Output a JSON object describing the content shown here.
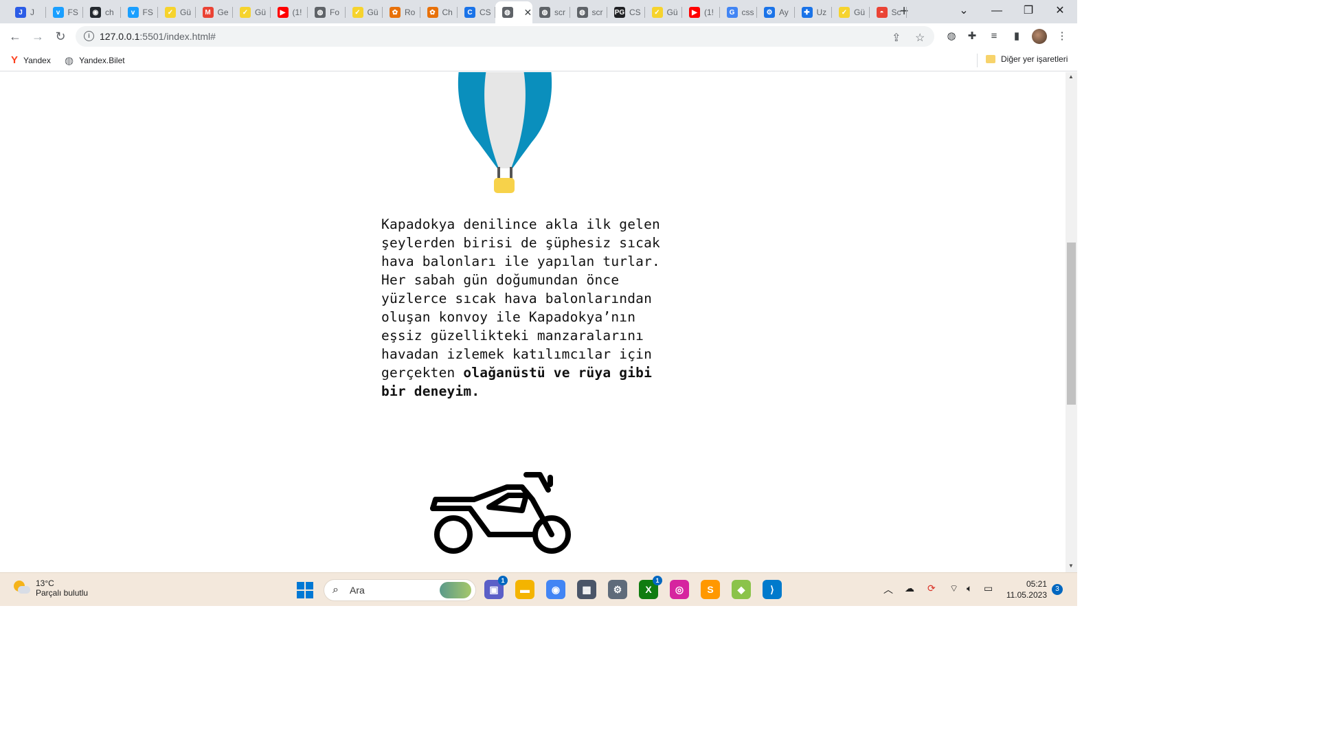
{
  "browser": {
    "tabs": [
      {
        "title": "J",
        "color": "#2b5ce6",
        "glyph": "J"
      },
      {
        "title": "FS",
        "color": "#1a9fff",
        "glyph": "v"
      },
      {
        "title": "ch",
        "color": "#24292f",
        "glyph": "◉"
      },
      {
        "title": "FS",
        "color": "#1a9fff",
        "glyph": "v"
      },
      {
        "title": "Gü",
        "color": "#f6d32d",
        "glyph": "✓"
      },
      {
        "title": "Ge",
        "color": "#ea4335",
        "glyph": "M"
      },
      {
        "title": "Gü",
        "color": "#f6d32d",
        "glyph": "✓"
      },
      {
        "title": "(1!",
        "color": "#ff0000",
        "glyph": "▶"
      },
      {
        "title": "Fo",
        "color": "#5f6368",
        "glyph": "◍"
      },
      {
        "title": "Gü",
        "color": "#f6d32d",
        "glyph": "✓"
      },
      {
        "title": "Ro",
        "color": "#e8710a",
        "glyph": "✿"
      },
      {
        "title": "Ch",
        "color": "#e8710a",
        "glyph": "✿"
      },
      {
        "title": "CS",
        "color": "#1a73e8",
        "glyph": "C"
      },
      {
        "title": "",
        "color": "#5f6368",
        "glyph": "◍"
      },
      {
        "title": "scr",
        "color": "#5f6368",
        "glyph": "◍"
      },
      {
        "title": "scr",
        "color": "#5f6368",
        "glyph": "◍"
      },
      {
        "title": "CS",
        "color": "#202124",
        "glyph": "PG"
      },
      {
        "title": "Gü",
        "color": "#f6d32d",
        "glyph": "✓"
      },
      {
        "title": "(1!",
        "color": "#ff0000",
        "glyph": "▶"
      },
      {
        "title": "css",
        "color": "#4285f4",
        "glyph": "G"
      },
      {
        "title": "Ay",
        "color": "#1a73e8",
        "glyph": "⚙"
      },
      {
        "title": "Uz",
        "color": "#1a73e8",
        "glyph": "✚"
      },
      {
        "title": "Gü",
        "color": "#f6d32d",
        "glyph": "✓"
      },
      {
        "title": "Sc",
        "color": "#ea4335",
        "glyph": "◓"
      }
    ],
    "new_tab": "+",
    "window_controls": [
      "⌄",
      "—",
      "❐",
      "✕"
    ],
    "url_host": "127.0.0.1",
    "url_rest": ":5501/index.html#",
    "bookmarks": [
      {
        "label": "Yandex",
        "icon": "Y"
      },
      {
        "label": "Yandex.Bilet",
        "icon": "◍"
      }
    ],
    "other_bookmarks": "Diğer yer işaretleri"
  },
  "page": {
    "paragraph_normal": "Kapadokya denilince akla ilk gelen şeylerden birisi de şüphesiz sıcak hava balonları ile yapılan turlar. Her sabah gün doğumundan önce yüzlerce sıcak hava balonlarından oluşan konvoy ile Kapadokya’nın eşsiz güzellikteki manzaralarını havadan izlemek katılımcılar için gerçekten",
    "paragraph_bold": "olağanüstü ve rüya gibi bir deneyim.",
    "balloon_colors": {
      "stripe_outer": "#0a8fbd",
      "stripe_inner": "#e6e6e6",
      "basket": "#f7d24a",
      "rope": "#555555"
    },
    "motorcycle_color": "#000000"
  },
  "taskbar": {
    "temperature": "13°C",
    "weather": "Parçalı bulutlu",
    "search_placeholder": "Ara",
    "apps": [
      {
        "name": "teams",
        "color": "#5b5fc7",
        "glyph": "▣",
        "badge": "1"
      },
      {
        "name": "explorer",
        "color": "#f4b400",
        "glyph": "▬",
        "badge": ""
      },
      {
        "name": "chrome",
        "color": "#4285f4",
        "glyph": "◉",
        "badge": ""
      },
      {
        "name": "calculator",
        "color": "#4a5568",
        "glyph": "▦",
        "badge": ""
      },
      {
        "name": "settings",
        "color": "#5f6b7a",
        "glyph": "⚙",
        "badge": ""
      },
      {
        "name": "xbox",
        "color": "#107c10",
        "glyph": "X",
        "badge": "1"
      },
      {
        "name": "instagram",
        "color": "#d6249f",
        "glyph": "◎",
        "badge": ""
      },
      {
        "name": "sublime",
        "color": "#ff9800",
        "glyph": "S",
        "badge": ""
      },
      {
        "name": "git-kraken",
        "color": "#8bc34a",
        "glyph": "◆",
        "badge": ""
      },
      {
        "name": "vscode",
        "color": "#007acc",
        "glyph": "⟩",
        "badge": ""
      }
    ],
    "time": "05:21",
    "date": "11.05.2023",
    "notifications": "3"
  }
}
